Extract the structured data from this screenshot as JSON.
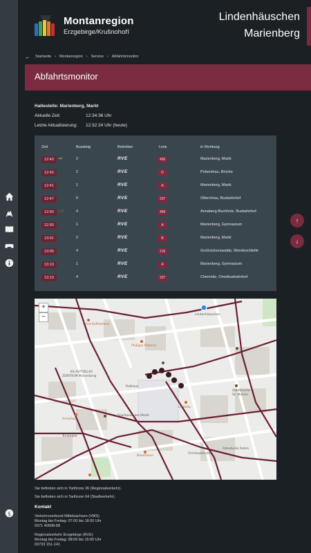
{
  "header": {
    "brand_title": "Montanregion",
    "brand_subtitle": "Erzgebirge/Krušnohoří",
    "place_line1": "Lindenhäuschen",
    "place_line2": "Marienberg"
  },
  "sidebar": {
    "items": [
      {
        "icon": "home-icon"
      },
      {
        "icon": "mining-icon"
      },
      {
        "icon": "book-icon"
      },
      {
        "icon": "gamepad-icon"
      },
      {
        "icon": "info-icon"
      },
      {
        "icon": "paragraph-icon"
      }
    ]
  },
  "breadcrumb": [
    "Startseite",
    "Montanregion",
    "Service",
    "Abfahrtsmonitor"
  ],
  "page_title": "Abfahrtsmonitor",
  "info": {
    "stop": "Haltestelle: Marienberg, Markt",
    "current_label": "Aktuelle Zeit:",
    "current_value": "12:34:36 Uhr",
    "updated_label": "Letzte Aktualisierung:",
    "updated_value": "12:32:24 Uhr (heute)"
  },
  "board": {
    "headers": [
      "Zeit",
      "Bussteig",
      "Betreiber",
      "Linie",
      "in Richtung"
    ],
    "rows": [
      {
        "time": "12:40",
        "delay": "+4",
        "platform": "2",
        "operator": "RVE",
        "line": "490",
        "destination": "Marienberg, Markt"
      },
      {
        "time": "12:40",
        "delay": "",
        "platform": "2",
        "operator": "RVE",
        "line": "D",
        "destination": "Pobershau, Brücke"
      },
      {
        "time": "12:41",
        "delay": "",
        "platform": "1",
        "operator": "RVE",
        "line": "A",
        "destination": "Marienberg, Markt"
      },
      {
        "time": "12:47",
        "delay": "",
        "platform": "5",
        "operator": "RVE",
        "line": "207",
        "destination": "Olbernhau, Busbahnhof"
      },
      {
        "time": "12:50",
        "delay": "+10",
        "platform": "4",
        "operator": "RVE",
        "line": "499",
        "destination": "Annaberg-Buchholz, Busbahnhof"
      },
      {
        "time": "12:50",
        "delay": "",
        "platform": "1",
        "operator": "RVE",
        "line": "A",
        "destination": "Marienberg, Gymnasium"
      },
      {
        "time": "13:01",
        "delay": "",
        "platform": "2",
        "operator": "RVE",
        "line": "B",
        "destination": "Marienberg, Markt"
      },
      {
        "time": "13:05",
        "delay": "",
        "platform": "4",
        "operator": "RVE",
        "line": "216",
        "destination": "Großrückerswalde, Wendeschleife"
      },
      {
        "time": "13:10",
        "delay": "",
        "platform": "1",
        "operator": "RVE",
        "line": "A",
        "destination": "Marienberg, Gymnasium"
      },
      {
        "time": "13:10",
        "delay": "",
        "platform": "4",
        "operator": "RVE",
        "line": "207",
        "destination": "Chemnitz, Omnibusbahnhof"
      }
    ]
  },
  "map": {
    "zoom_in": "+",
    "zoom_out": "−",
    "labels": {
      "lindenhaeuschen": "Lindenhäuschen",
      "pizzeria": "Philipps Pizzeria",
      "kaffeehaus": "Ernst Kaffeehaus",
      "ks": "KS AUTOGLAS ZENTRUM Marienberg",
      "bella": "La Bella",
      "sparkasse": "Sparkasse am Markt",
      "kirche": "Stadtkirche St. Marien",
      "rathaus": "Rathaus",
      "trinkhalle": "Trinkhalle",
      "amehaus": "Armehaus",
      "christkirche": "Christuskirche",
      "fotostudio": "Fotostudio Rahm",
      "baumhaus": "Baumhaus"
    },
    "stop_numbers": [
      "6",
      "5",
      "4",
      "3",
      "2",
      "1"
    ]
  },
  "footer": {
    "zone1": "Sie befinden sich in Tarifzone 26 (Regionalverkehr).",
    "zone2": "Sie befinden sich in Tarifzone 64 (Stadtverkehr).",
    "contact_title": "Kontakt",
    "vms_name": "Verkehrsverbund Mittelsachsen (VMS)",
    "vms_hours": "Montag bis Freitag: 07:00 bis 18:00 Uhr",
    "vms_phone": "0371 40008-88",
    "rve_name": "Regionalverkehr Erzgebirge (RVE)",
    "rve_hours": "Montag bis Freitag: 08:00 bis 15:00 Uhr",
    "rve_phone": "03733 151-141"
  },
  "colors": {
    "accent": "#7b2b3f",
    "background": "#1b2024",
    "sidebar": "#343c42",
    "board": "#3a464d"
  }
}
